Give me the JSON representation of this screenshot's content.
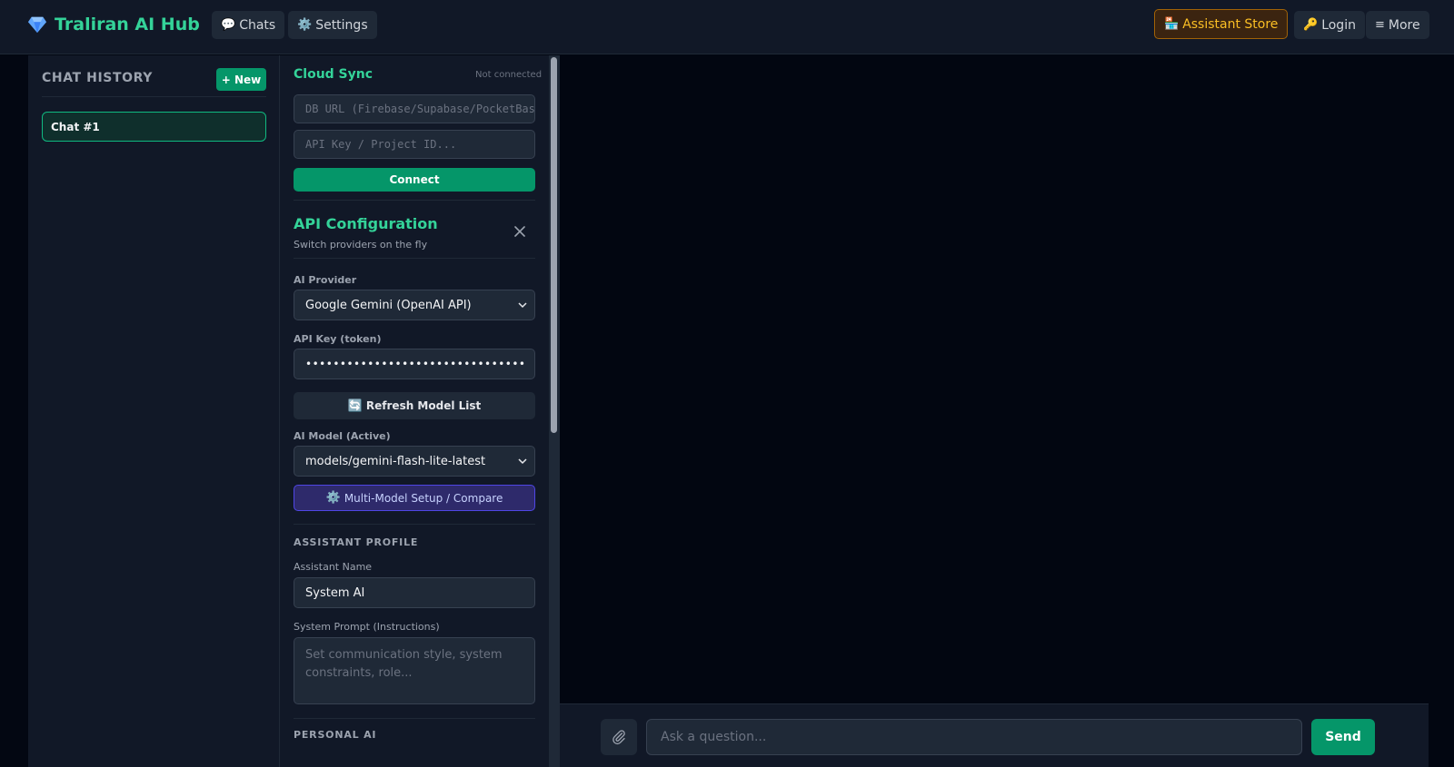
{
  "header": {
    "brand": "Traliran AI Hub",
    "chats_label": "Chats",
    "settings_label": "Settings",
    "store_label": "Assistant Store",
    "login_label": "Login",
    "more_label": "More"
  },
  "sidebar": {
    "title": "CHAT HISTORY",
    "new_label": "+ New",
    "chats": [
      {
        "label": "Chat #1",
        "active": true
      }
    ]
  },
  "cloud_sync": {
    "title": "Cloud Sync",
    "status": "Not connected",
    "db_url_placeholder": "DB URL (Firebase/Supabase/PocketBase)",
    "api_key_placeholder": "API Key / Project ID...",
    "connect_label": "Connect"
  },
  "api_config": {
    "title": "API Configuration",
    "subtitle": "Switch providers on the fly",
    "provider_label": "AI Provider",
    "provider_value": "Google Gemini (OpenAI API)",
    "api_key_label": "API Key (token)",
    "api_key_value": "••••••••••••••••••••••••••••••••",
    "refresh_label": "Refresh Model List",
    "model_label": "AI Model (Active)",
    "model_value": "models/gemini-flash-lite-latest",
    "multi_label": "Multi-Model Setup / Compare"
  },
  "assistant_profile": {
    "section": "ASSISTANT PROFILE",
    "name_label": "Assistant Name",
    "name_value": "System AI",
    "prompt_label": "System Prompt (Instructions)",
    "prompt_placeholder": "Set communication style, system constraints, role..."
  },
  "personal_ai": {
    "section": "PERSONAL AI"
  },
  "composer": {
    "placeholder": "Ask a question...",
    "send_label": "Send"
  },
  "colors": {
    "accent": "#34d399",
    "primary_button": "#059669",
    "store_text": "#fbbf24",
    "multi_button": "#2e2a6b"
  }
}
